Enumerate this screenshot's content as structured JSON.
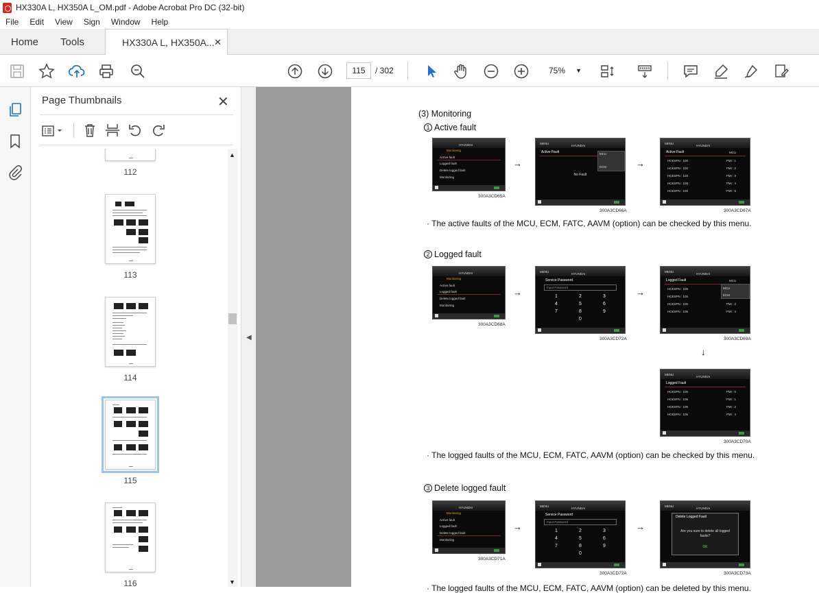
{
  "window": {
    "title": "HX330A L, HX350A L_OM.pdf - Adobe Acrobat Pro DC (32-bit)"
  },
  "menu": [
    "File",
    "Edit",
    "View",
    "Sign",
    "Window",
    "Help"
  ],
  "tabs": {
    "home": "Home",
    "tools": "Tools",
    "document": "HX330A L, HX350A..."
  },
  "toolbar": {
    "page_current": "115",
    "page_total": "/ 302",
    "zoom": "75%"
  },
  "panel": {
    "title": "Page Thumbnails",
    "thumbnails": [
      {
        "label": "112",
        "selected": false
      },
      {
        "label": "113",
        "selected": false
      },
      {
        "label": "114",
        "selected": false
      },
      {
        "label": "115",
        "selected": true
      },
      {
        "label": "116",
        "selected": false
      }
    ]
  },
  "doc": {
    "section": "(3) Monitoring",
    "active": {
      "num": "①",
      "title": "Active fault",
      "desc": "·  The active faults of the MCU, ECM, FATC, AAVM (option) can be checked by this menu.",
      "captions": [
        "300A3CD65A",
        "300A3CD66A",
        "300A3CD67A"
      ]
    },
    "logged": {
      "num": "②",
      "title": "Logged fault",
      "desc": "·  The logged faults of the MCU, ECM, FATC, AAVM (option) can be checked by this menu.",
      "captions": [
        "300A3CD68A",
        "300A3CD72A",
        "300A3CD69A",
        "300A3CD70A"
      ]
    },
    "delete": {
      "num": "③",
      "title": "Delete logged fault",
      "captions": [
        "300A3CD71A",
        "300A3CD72A",
        "300A3CD73A"
      ],
      "trailing": "·  The logged faults of the MCU, ECM, FATC, AAVM (option) can be deleted by this menu."
    },
    "screens": {
      "brand": "HYUNDAI",
      "menu_label": "MENU",
      "menu_items": [
        "Active fault",
        "Logged fault",
        "Delete logged fault",
        "Monitoring"
      ],
      "monitoring_header": "Monitoring",
      "active_fault_header": "Active Fault",
      "logged_fault_header": "Logged Fault",
      "no_fault": "No Fault",
      "ctrl_mcu": "MCU",
      "ctrl_ecm": "ECM",
      "rows_active": [
        "HCESPN : 100",
        "HCESPN : 100",
        "HCESPN : 100",
        "HCESPN : 100",
        "HCESPN : 100"
      ],
      "fmis_active": [
        "FMI : 1",
        "FMI : 2",
        "FMI : 3",
        "FMI : 4",
        "FMI : 5"
      ],
      "rows_logged": [
        "HCESPN : 105",
        "HCESPN : 105",
        "HCESPN : 105",
        "HCESPN : 105"
      ],
      "fmis_logged": [
        "FMI : 0",
        "FMI : 1",
        "FMI : 2",
        "FMI : 4"
      ],
      "password_title": "Service Password",
      "password_placeholder": "Input Password",
      "keypad": [
        "1",
        "2",
        "3",
        "4",
        "5",
        "6",
        "7",
        "8",
        "9",
        "0"
      ],
      "delete_title": "Delete Logged Fault",
      "delete_q1": "Are you sure to delete all logged",
      "delete_q2": "faults?",
      "ok": "OK"
    }
  }
}
